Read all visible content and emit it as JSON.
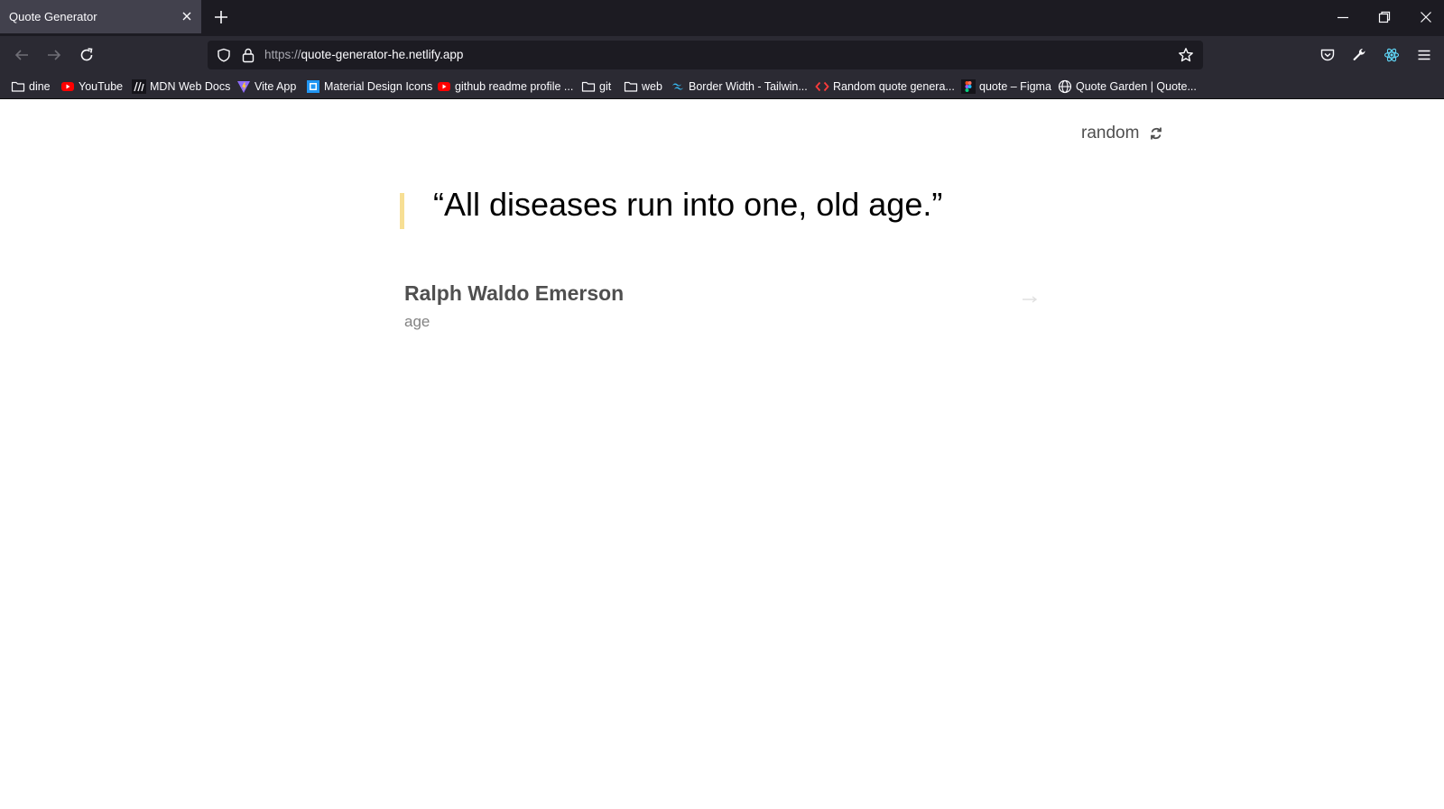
{
  "browser": {
    "tab_title": "Quote Generator",
    "url_protocol": "https://",
    "url_host": "quote-generator-he.netlify.app"
  },
  "bookmarks": [
    {
      "label": "dine",
      "icon": "folder-icon"
    },
    {
      "label": "YouTube",
      "icon": "youtube-icon"
    },
    {
      "label": "MDN Web Docs",
      "icon": "mdn-icon"
    },
    {
      "label": "Vite App",
      "icon": "vite-icon"
    },
    {
      "label": "Material Design Icons",
      "icon": "material-design-icon"
    },
    {
      "label": "github readme profile ...",
      "icon": "youtube-icon"
    },
    {
      "label": "git",
      "icon": "folder-icon"
    },
    {
      "label": "web",
      "icon": "folder-icon"
    },
    {
      "label": "Border Width - Tailwin...",
      "icon": "tailwind-icon"
    },
    {
      "label": "Random quote genera...",
      "icon": "code-icon"
    },
    {
      "label": "quote – Figma",
      "icon": "figma-icon"
    },
    {
      "label": "Quote Garden | Quote...",
      "icon": "globe-icon"
    }
  ],
  "app": {
    "random_label": "random",
    "quote": "“All diseases run into one, old age.”",
    "author": "Ralph Waldo Emerson",
    "genre": "age",
    "accent_color": "#f7df94"
  }
}
